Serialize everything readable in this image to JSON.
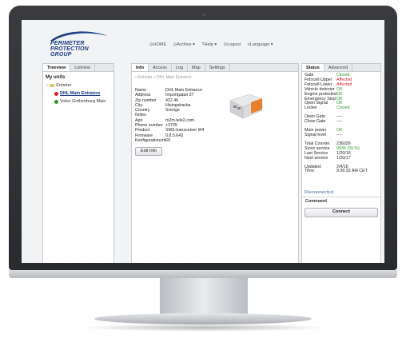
{
  "logo": {
    "line1": "PERIMETER",
    "line2": "PROTECTION",
    "line3": "GROUP"
  },
  "nav": {
    "home": "⊙HOME",
    "archive": "⊙Archive ▾",
    "help": "?Help ▾",
    "logout": "⊙Logout",
    "language": "≡Language ▾"
  },
  "tree": {
    "tabs": [
      "Treeview",
      "Listview"
    ],
    "title": "My units",
    "root": "Enheter",
    "items": [
      {
        "label": "DHL Main Entrance",
        "status": "red"
      },
      {
        "label": "Volvo Gothenburg Main",
        "status": "green"
      }
    ]
  },
  "info": {
    "tabs": [
      "Info",
      "Access",
      "Log",
      "Map",
      "Settings"
    ],
    "breadcrumb": "» Enheter » DHL Main Entrance",
    "rows": [
      {
        "k": "Name",
        "v": "DHL Main Entrance"
      },
      {
        "k": "Address",
        "v": "Importgatan 27"
      },
      {
        "k": "Zip number",
        "v": "422 46"
      },
      {
        "k": "City",
        "v": "Hisingsbacka"
      },
      {
        "k": "Country",
        "v": "Sverige"
      },
      {
        "k": "Notes",
        "v": ""
      },
      {
        "k": "Apn",
        "v": "m2m.tele2.com"
      },
      {
        "k": "Phone number",
        "v": "+3725"
      },
      {
        "k": "Product",
        "v": "SMS-transceiver W4"
      },
      {
        "k": "Firmware",
        "v": "0.8.5.643"
      },
      {
        "k": "Konfigurationsrn",
        "v": "60"
      }
    ],
    "edit_button": "Edit Info"
  },
  "status": {
    "tabs": [
      "Status",
      "Advanced"
    ],
    "group1": [
      {
        "k": "Gate",
        "v": "Closed",
        "cls": "closed"
      },
      {
        "k": "Fotocell Upper",
        "v": "Affected",
        "cls": "affected"
      },
      {
        "k": "Fotocell Lower",
        "v": "Affected",
        "cls": "affected"
      },
      {
        "k": "Vehicle detector",
        "v": "OK",
        "cls": "ok"
      },
      {
        "k": "Engine protection",
        "v": "OK",
        "cls": "ok"
      },
      {
        "k": "Emergency Stop",
        "v": "OK",
        "cls": "ok"
      },
      {
        "k": "Open Signal",
        "v": "OK",
        "cls": "ok"
      },
      {
        "k": "Locker",
        "v": "Closed",
        "cls": "closed"
      }
    ],
    "group2": [
      {
        "k": "Open Gate",
        "v": "----",
        "cls": ""
      },
      {
        "k": "Close Gate",
        "v": "----",
        "cls": ""
      }
    ],
    "group3": [
      {
        "k": "Main power",
        "v": "OK",
        "cls": "ok"
      },
      {
        "k": "Signal level",
        "v": "----",
        "cls": ""
      }
    ],
    "group4": [
      {
        "k": "Total Counter",
        "v": "236026",
        "cls": ""
      },
      {
        "k": "Since service",
        "v": "9036 (39 %)",
        "cls": "closed"
      },
      {
        "k": "Last Service",
        "v": "1/20/16",
        "cls": ""
      },
      {
        "k": "Next service",
        "v": "1/20/17",
        "cls": ""
      }
    ],
    "group5": [
      {
        "k": "Updated:",
        "v": "2/4/16",
        "cls": ""
      },
      {
        "k": "Time:",
        "v": "9:36:32 AM CET",
        "cls": ""
      }
    ],
    "connection": "Disconnected",
    "command_label": "Command",
    "connect_button": "Connect"
  }
}
